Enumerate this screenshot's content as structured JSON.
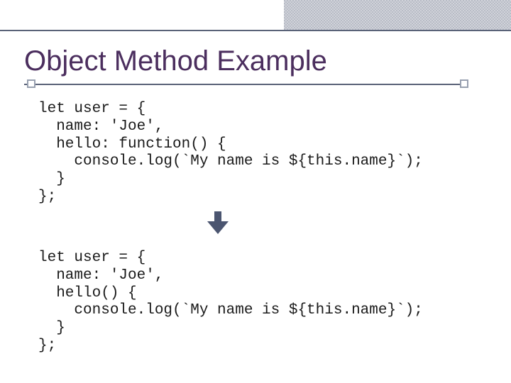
{
  "title": "Object Method Example",
  "code1": "let user = {\n  name: 'Joe',\n  hello: function() {\n    console.log(`My name is ${this.name}`);\n  }\n};",
  "code2": "let user = {\n  name: 'Joe',\n  hello() {\n    console.log(`My name is ${this.name}`);\n  }\n};"
}
